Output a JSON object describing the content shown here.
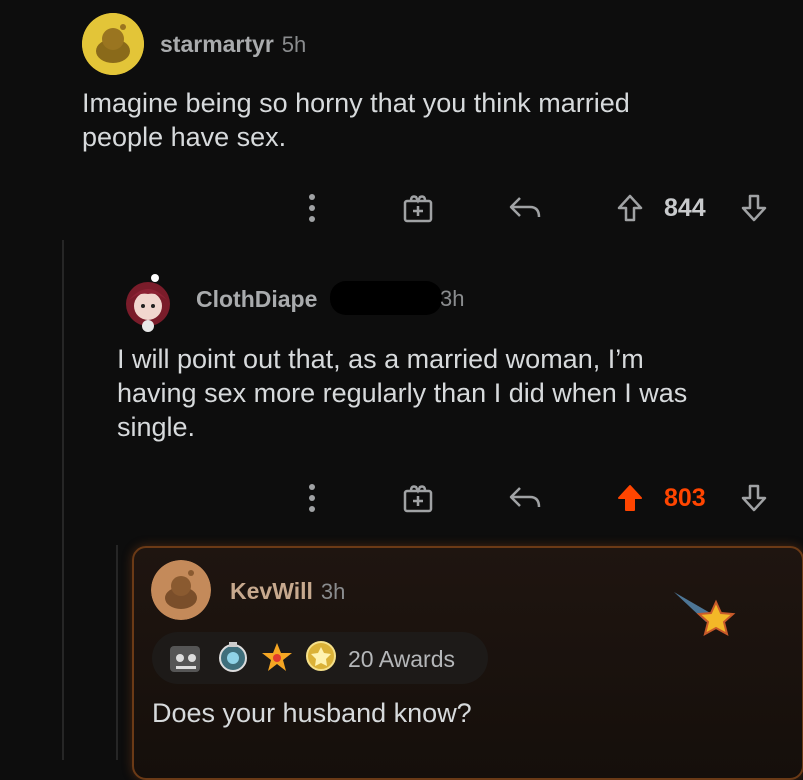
{
  "comments": [
    {
      "username": "starmartyr",
      "time": "5h",
      "body": "Imagine being so horny that you think married people have sex.",
      "body_lines": [
        "Imagine being so horny that you think married",
        "people have sex."
      ],
      "score": "844",
      "upvoted": false
    },
    {
      "username": "ClothDiape",
      "time": "3h",
      "body": "I will point out that, as a married woman, I’m having sex more regularly than I did when I was single.",
      "body_lines": [
        "I will point out that, as a married woman, I’m",
        "having sex more regularly than I did when I was",
        "single."
      ],
      "score": "803",
      "upvoted": true
    },
    {
      "username": "KevWill",
      "time": "3h",
      "awards": "20 Awards",
      "body": "Does your husband know?"
    }
  ],
  "colors": {
    "background": "#0d0d0d",
    "upvote_active": "#ff4500",
    "highlight_border": "#6b3a16"
  },
  "icons": [
    "more-options-icon",
    "gift-award-icon",
    "reply-icon",
    "upvote-icon",
    "downvote-icon",
    "star-award-icon"
  ]
}
